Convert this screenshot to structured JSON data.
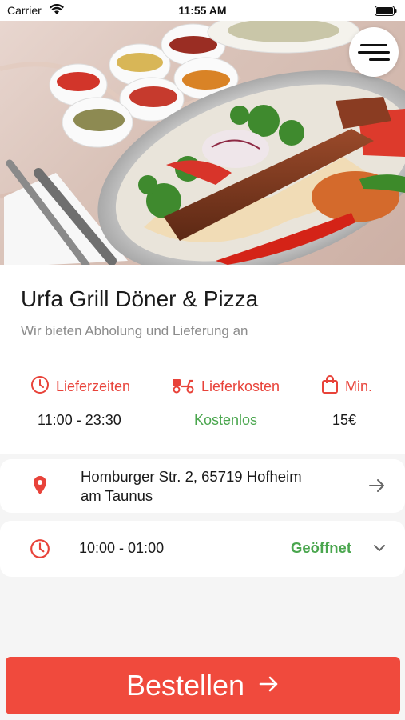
{
  "status_bar": {
    "carrier": "Carrier",
    "time": "11:55 AM"
  },
  "hero": {
    "image_alt": "Adana kebab platter"
  },
  "restaurant": {
    "name": "Urfa Grill Döner & Pizza",
    "tagline": "Wir bieten Abholung und Lieferung an"
  },
  "stats": {
    "delivery_times": {
      "label": "Lieferzeiten",
      "value": "11:00 - 23:30",
      "icon": "clock-icon"
    },
    "delivery_cost": {
      "label": "Lieferkosten",
      "value": "Kostenlos",
      "icon": "scooter-icon"
    },
    "minimum": {
      "label": "Min.",
      "value": "15€",
      "icon": "shopping-bag-icon"
    }
  },
  "address": {
    "line1": "Homburger Str. 2, 65719 Hofheim",
    "line2": "am Taunus"
  },
  "hours": {
    "value": "10:00 - 01:00",
    "status": "Geöffnet"
  },
  "order_button": {
    "label": "Bestellen"
  },
  "colors": {
    "accent": "#f04a3d",
    "open": "#4aa64e",
    "stat_label": "#e8433a"
  }
}
